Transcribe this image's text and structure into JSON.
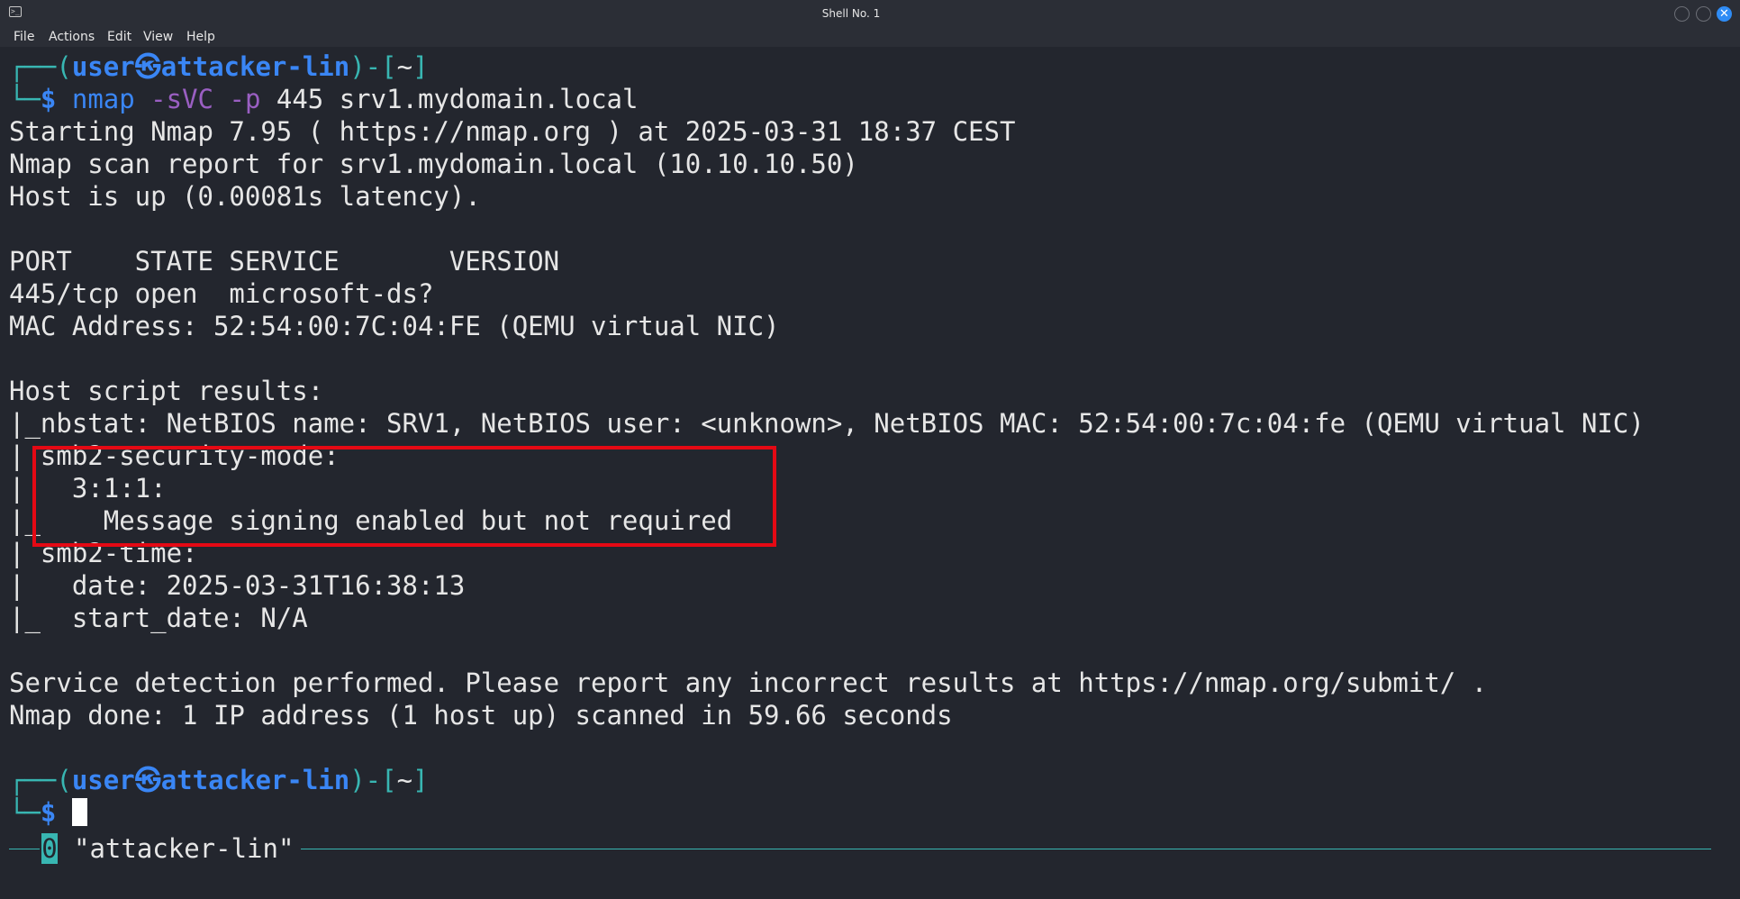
{
  "window": {
    "title": "Shell No. 1",
    "app_icon": "terminal-icon",
    "close_glyph": "✕",
    "colors": {
      "background": "#23262e",
      "chrome": "#2b2e36",
      "prompt_frame": "#38b6b2",
      "prompt_user": "#3a86f5",
      "option": "#9a5fc2",
      "highlight_box": "#e50914",
      "close_button": "#2f8cf5"
    }
  },
  "menu": {
    "file": "File",
    "actions": "Actions",
    "edit": "Edit",
    "view": "View",
    "help": "Help"
  },
  "prompt1": {
    "frame_top": "┌──(",
    "user": "user",
    "sep": "㉿",
    "host": "attacker-lin",
    "mid": ")-[",
    "dir": "~",
    "end": "]",
    "frame_bottom": "└─",
    "dollar": "$",
    "cmd": "nmap",
    "opt1": "-sVC",
    "opt2": "-p",
    "args": "445 srv1.mydomain.local"
  },
  "output": {
    "l1": "Starting Nmap 7.95 ( https://nmap.org ) at 2025-03-31 18:37 CEST",
    "l2": "Nmap scan report for srv1.mydomain.local (10.10.10.50)",
    "l3": "Host is up (0.00081s latency).",
    "l4": "PORT    STATE SERVICE       VERSION",
    "l5": "445/tcp open  microsoft-ds?",
    "l6": "MAC Address: 52:54:00:7C:04:FE (QEMU virtual NIC)",
    "l7": "Host script results:",
    "l8": "|_nbstat: NetBIOS name: SRV1, NetBIOS user: <unknown>, NetBIOS MAC: 52:54:00:7c:04:fe (QEMU virtual NIC)",
    "l9": "| smb2-security-mode:",
    "l10": "|   3:1:1:",
    "l11": "|_    Message signing enabled but not required",
    "l12": "| smb2-time:",
    "l13": "|   date: 2025-03-31T16:38:13",
    "l14": "|_  start_date: N/A",
    "l15": "Service detection performed. Please report any incorrect results at https://nmap.org/submit/ .",
    "l16": "Nmap done: 1 IP address (1 host up) scanned in 59.66 seconds"
  },
  "prompt2": {
    "frame_top": "┌──(",
    "user": "user",
    "sep": "㉿",
    "host": "attacker-lin",
    "mid": ")-[",
    "dir": "~",
    "end": "]",
    "frame_bottom": "└─",
    "dollar": "$"
  },
  "statusbar": {
    "window_index": "0",
    "window_name": "\"attacker-lin\""
  }
}
